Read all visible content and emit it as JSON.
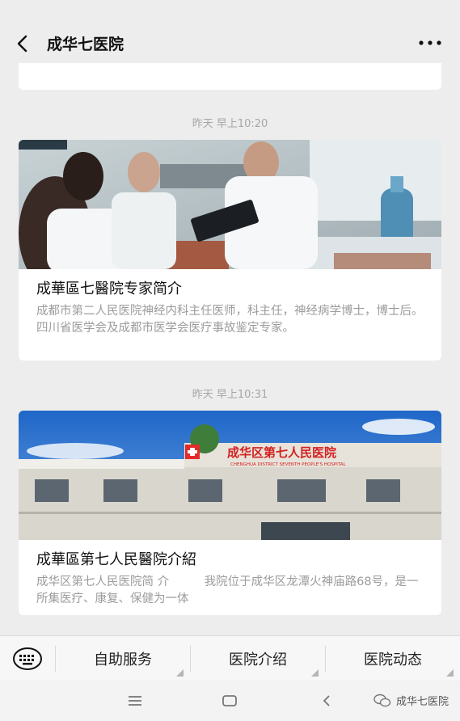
{
  "header": {
    "title": "成华七医院",
    "back_icon": "chevron-left-icon",
    "more_icon": "more-dots-icon"
  },
  "feed": {
    "messages": [
      {
        "time": "昨天 早上10:20",
        "title": "成華區七醫院专家简介",
        "description": "成都市第二人民医院神经内科主任医师，科主任，神经病学博士，博士后。四川省医学会及成都市医学会医疗事故鉴定专家。"
      },
      {
        "time": "昨天 早上10:31",
        "title": "成華區第七人民醫院介紹",
        "description": "成华区第七人民医院简 介　　　我院位于成华区龙潭火神庙路68号，是一所集医疗、康复、保健为一体",
        "image_sign": "成华区第七人民医院",
        "image_sign_en": "CHENGHUA DISTRICT SEVENTH PEOPLE'S HOSPITAL"
      }
    ]
  },
  "menu": {
    "keyboard_icon": "keyboard-icon",
    "items": [
      {
        "label": "自助服务"
      },
      {
        "label": "医院介绍"
      },
      {
        "label": "医院动态"
      }
    ]
  },
  "system_nav": {
    "watermark": "成华七医院"
  }
}
